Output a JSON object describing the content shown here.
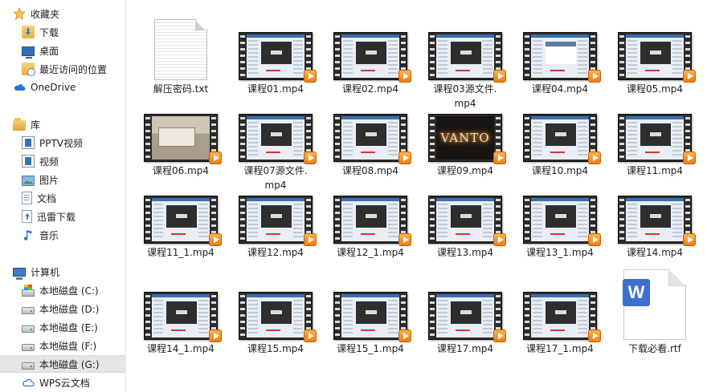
{
  "nav": {
    "favorites": {
      "label": "收藏夹",
      "items": [
        {
          "label": "下载",
          "icon": "download-folder-icon"
        },
        {
          "label": "桌面",
          "icon": "desktop-icon"
        },
        {
          "label": "最近访问的位置",
          "icon": "recent-places-icon"
        }
      ]
    },
    "onedrive": {
      "label": "OneDrive",
      "icon": "onedrive-cloud-icon"
    },
    "libraries": {
      "label": "库",
      "items": [
        {
          "label": "PPTV视频",
          "icon": "video-library-icon"
        },
        {
          "label": "视频",
          "icon": "video-library-icon"
        },
        {
          "label": "图片",
          "icon": "pictures-library-icon"
        },
        {
          "label": "文档",
          "icon": "documents-library-icon"
        },
        {
          "label": "迅雷下载",
          "icon": "xunlei-download-icon"
        },
        {
          "label": "音乐",
          "icon": "music-note-icon"
        }
      ]
    },
    "computer": {
      "label": "计算机",
      "items": [
        {
          "label": "本地磁盘 (C:)",
          "icon": "system-drive-icon"
        },
        {
          "label": "本地磁盘 (D:)",
          "icon": "hard-drive-icon"
        },
        {
          "label": "本地磁盘 (E:)",
          "icon": "hard-drive-icon"
        },
        {
          "label": "本地磁盘 (F:)",
          "icon": "hard-drive-icon"
        },
        {
          "label": "本地磁盘 (G:)",
          "icon": "hard-drive-icon",
          "selected": true
        }
      ]
    },
    "wps_cloud": {
      "label": "WPS云文档",
      "icon": "wps-cloud-icon"
    }
  },
  "files": [
    {
      "name": "解压密码.txt",
      "type": "txt"
    },
    {
      "name": "课程01.mp4",
      "type": "mp4"
    },
    {
      "name": "课程02.mp4",
      "type": "mp4"
    },
    {
      "name": "课程03源文件.mp4",
      "type": "mp4"
    },
    {
      "name": "课程04.mp4",
      "type": "mp4"
    },
    {
      "name": "课程05.mp4",
      "type": "mp4"
    },
    {
      "name": "课程06.mp4",
      "type": "mp4"
    },
    {
      "name": "课程07源文件.mp4",
      "type": "mp4"
    },
    {
      "name": "课程08.mp4",
      "type": "mp4"
    },
    {
      "name": "课程09.mp4",
      "type": "mp4",
      "thumb_text": "VANTO"
    },
    {
      "name": "课程10.mp4",
      "type": "mp4"
    },
    {
      "name": "课程11.mp4",
      "type": "mp4"
    },
    {
      "name": "课程11_1.mp4",
      "type": "mp4"
    },
    {
      "name": "课程12.mp4",
      "type": "mp4"
    },
    {
      "name": "课程12_1.mp4",
      "type": "mp4"
    },
    {
      "name": "课程13.mp4",
      "type": "mp4"
    },
    {
      "name": "课程13_1.mp4",
      "type": "mp4"
    },
    {
      "name": "课程14.mp4",
      "type": "mp4"
    },
    {
      "name": "课程14_1.mp4",
      "type": "mp4"
    },
    {
      "name": "课程15.mp4",
      "type": "mp4"
    },
    {
      "name": "课程15_1.mp4",
      "type": "mp4"
    },
    {
      "name": "课程17.mp4",
      "type": "mp4"
    },
    {
      "name": "课程17_1.mp4",
      "type": "mp4"
    },
    {
      "name": "下载必看.rtf",
      "type": "rtf",
      "badge": "W"
    }
  ]
}
